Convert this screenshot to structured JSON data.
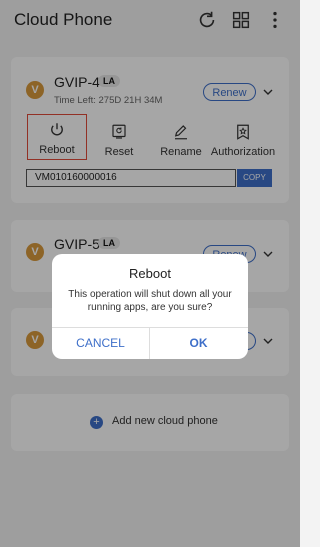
{
  "app": {
    "title": "Cloud Phone"
  },
  "header_icons": [
    "refresh-icon",
    "grid-icon",
    "more-vert-icon"
  ],
  "phones": [
    {
      "vip": "V",
      "name": "GVIP-4",
      "region": "LA",
      "time_left": "Time Left: 275D 21H 34M",
      "renew_label": "Renew",
      "expanded": true,
      "actions": [
        {
          "label": "Reboot",
          "icon": "power-icon",
          "selected": true
        },
        {
          "label": "Reset",
          "icon": "reset-icon"
        },
        {
          "label": "Rename",
          "icon": "pencil-icon"
        },
        {
          "label": "Authorization",
          "icon": "authorization-icon"
        }
      ],
      "device_id": "VM010160000016",
      "copy_label": "COPY"
    },
    {
      "vip": "V",
      "name": "GVIP-5",
      "region": "LA",
      "renew_label": "Renew"
    },
    {
      "vip": "V",
      "renew_label": "Renew"
    }
  ],
  "add_card": {
    "label": "Add new cloud phone"
  },
  "dialog": {
    "title": "Reboot",
    "message": "This operation will shut down all your running apps, are you sure?",
    "cancel_label": "CANCEL",
    "ok_label": "OK"
  },
  "colors": {
    "accent": "#3e6fc9",
    "vip": "#d99a3c",
    "selection": "#e04a3a"
  }
}
